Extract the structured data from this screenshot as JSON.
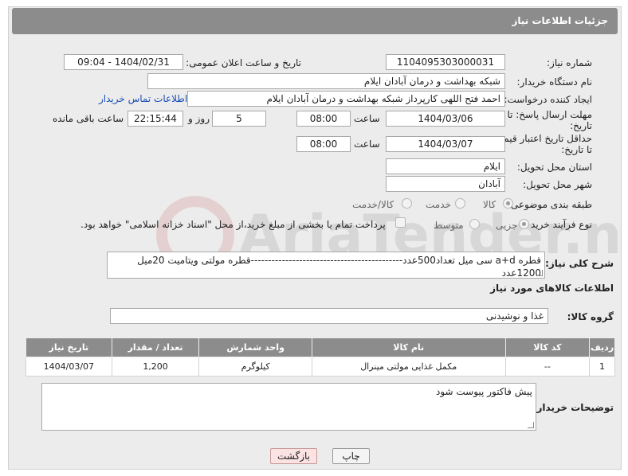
{
  "header": {
    "title": "جزئیات اطلاعات نیاز"
  },
  "form": {
    "need_number_label": "شماره نیاز:",
    "need_number": "1104095303000031",
    "announce_label": "تاریخ و ساعت اعلان عمومی:",
    "announce_value": "1404/02/31 - 09:04",
    "buyer_org_label": "نام دستگاه خریدار:",
    "buyer_org": "شبکه بهداشت و درمان آبادان ایلام",
    "creator_label": "ایجاد کننده درخواست:",
    "creator": "احمد فتح اللهی کارپرداز شبکه بهداشت و درمان آبادان ایلام",
    "contact_link": "اطلاعات تماس خریدار",
    "reply_deadline_label_1": "مهلت ارسال پاسخ: تا",
    "reply_deadline_label_2": "تاریخ:",
    "reply_date": "1404/03/06",
    "time_label": "ساعت",
    "reply_time": "08:00",
    "days_value": "5",
    "days_label": "روز و",
    "remaining_time": "22:15:44",
    "remaining_label": "ساعت باقی مانده",
    "price_validity_label_1": "حداقل تاریخ اعتبار قیمت:",
    "price_validity_label_2": "تا تاریخ:",
    "price_date": "1404/03/07",
    "price_time": "08:00",
    "province_label": "استان محل تحویل:",
    "province": "ایلام",
    "city_label": "شهر محل تحویل:",
    "city": "آبادان",
    "category_label": "طبقه بندی موضوعی:",
    "category_options": [
      "کالا",
      "خدمت",
      "کالا/خدمت"
    ],
    "process_label": "نوع فرآیند خرید :",
    "process_options": [
      "جزیی",
      "متوسط"
    ],
    "treasury_note": "پرداخت تمام یا بخشی از مبلغ خرید،از محل \"اسناد خزانه اسلامی\" خواهد بود."
  },
  "description": {
    "label": "شرح کلی نیاز:",
    "line1": "قطره a+d سی میل تعداد500عدد--------------------------------------------قطره مولتی ویتامیت 20میل",
    "line2": "1200عدد"
  },
  "goods": {
    "section_title": "اطلاعات کالاهای مورد نیاز",
    "group_label": "گروه کالا:",
    "group_value": "غذا و نوشیدنی",
    "columns": [
      "ردیف",
      "کد کالا",
      "نام کالا",
      "واحد شمارش",
      "تعداد / مقدار",
      "تاریخ نیاز"
    ],
    "rows": [
      [
        "1",
        "--",
        "مکمل غذایی مولتی مینرال",
        "کیلوگرم",
        "1,200",
        "1404/03/07"
      ]
    ]
  },
  "buyer_notes": {
    "label": "توضیحات خریدار:",
    "value": "پیش فاکتور پیوست شود"
  },
  "buttons": {
    "print": "چاپ",
    "back": "بازگشت"
  },
  "watermark": {
    "text": "AriaTender.neT"
  }
}
